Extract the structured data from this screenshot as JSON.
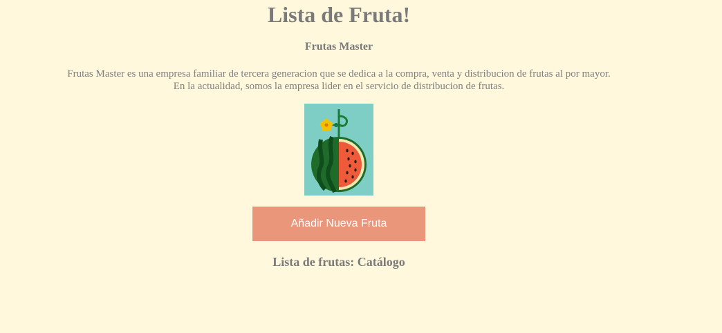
{
  "header": {
    "title": "Lista de Fruta!",
    "subtitle": "Frutas Master"
  },
  "description": {
    "line1": "Frutas Master es una empresa familiar de tercera generacion que se dedica a la compra, venta y distribucion de frutas al por mayor.",
    "line2": "En la actualidad, somos la empresa lider en el servicio de distribucion de frutas."
  },
  "image": {
    "icon": "watermelon-illustration",
    "background_color": "#7fcec6"
  },
  "actions": {
    "add_fruit_label": "Añadir Nueva Fruta",
    "button_color": "#e9967a"
  },
  "catalog": {
    "heading": "Lista de frutas: Catálogo"
  },
  "colors": {
    "page_background": "#fff8dc",
    "text": "#808080"
  }
}
